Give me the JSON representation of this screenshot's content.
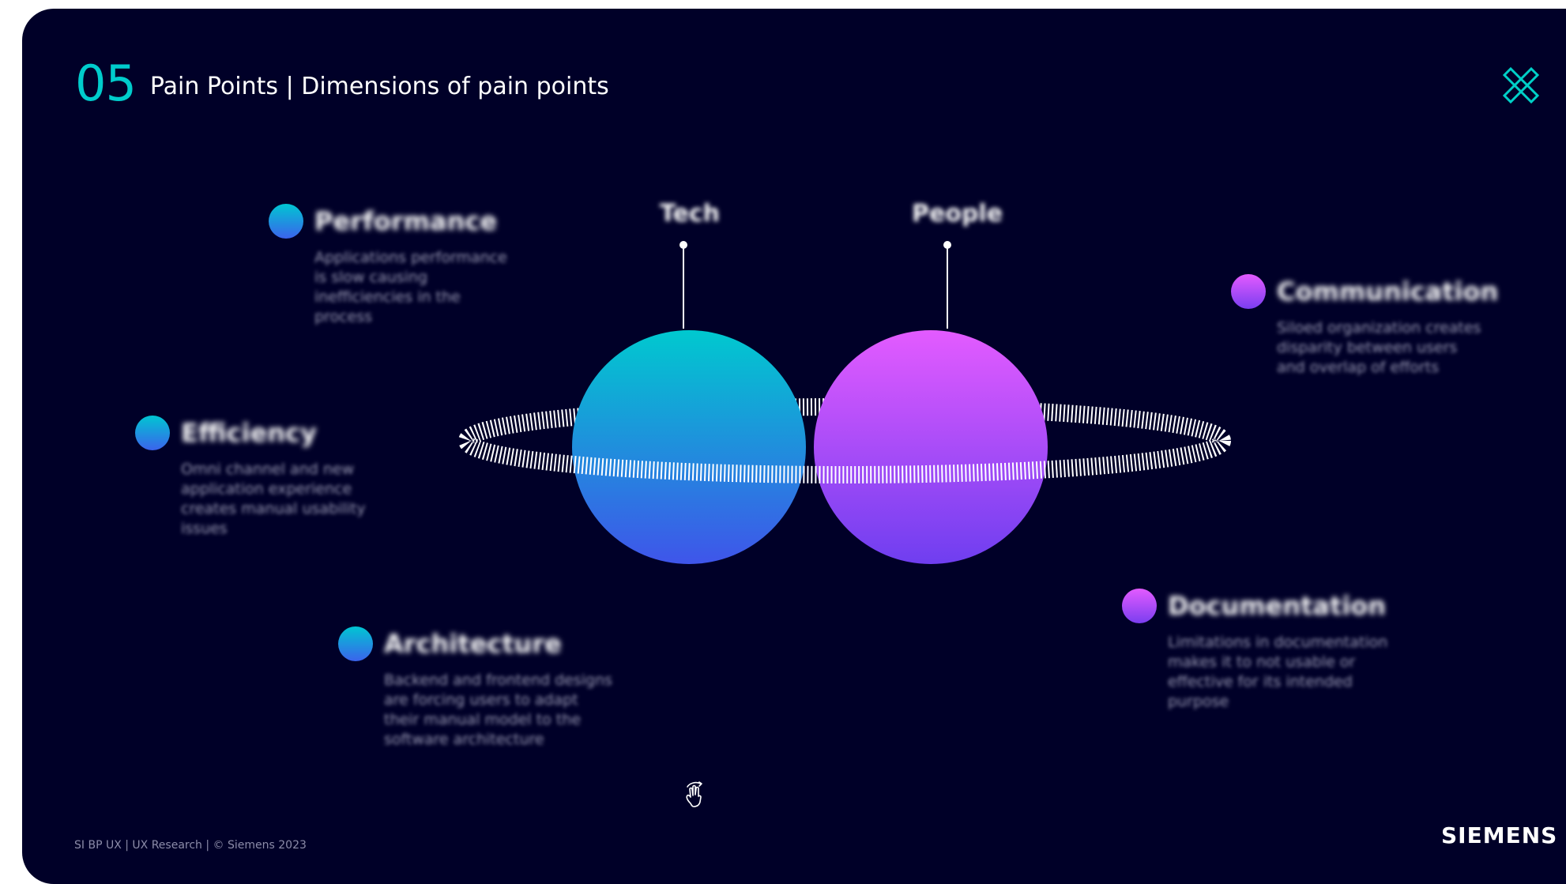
{
  "header": {
    "section_number": "05",
    "title": "Pain Points | Dimensions of pain points"
  },
  "planets": {
    "tech_label": "Tech",
    "people_label": "People"
  },
  "tech_items": [
    {
      "title": "Performance",
      "description": "Applications performance is slow causing inefficiencies in the process"
    },
    {
      "title": "Efficiency",
      "description": "Omni channel and new application experience creates manual usability issues"
    },
    {
      "title": "Architecture",
      "description": "Backend and frontend designs are forcing users to adapt their manual model to the software architecture"
    }
  ],
  "people_items": [
    {
      "title": "Communication",
      "description": "Siloed organization creates disparity between users and overlap of efforts"
    },
    {
      "title": "Documentation",
      "description": "Limitations in documentation makes it to not usable or effective for its intended purpose"
    }
  ],
  "footer": {
    "credit": "SI BP UX | UX Research | © Siemens 2023",
    "brand": "SIEMENS"
  },
  "icons": {
    "corner_logo": "crossed-x-logo-icon",
    "interaction": "touch-gesture-icon"
  },
  "colors": {
    "background": "#000028",
    "accent_teal": "#00cccc",
    "tech_gradient": [
      "#00c6d2",
      "#3b63ec"
    ],
    "people_gradient": [
      "#e35bff",
      "#7a3ef0"
    ]
  }
}
